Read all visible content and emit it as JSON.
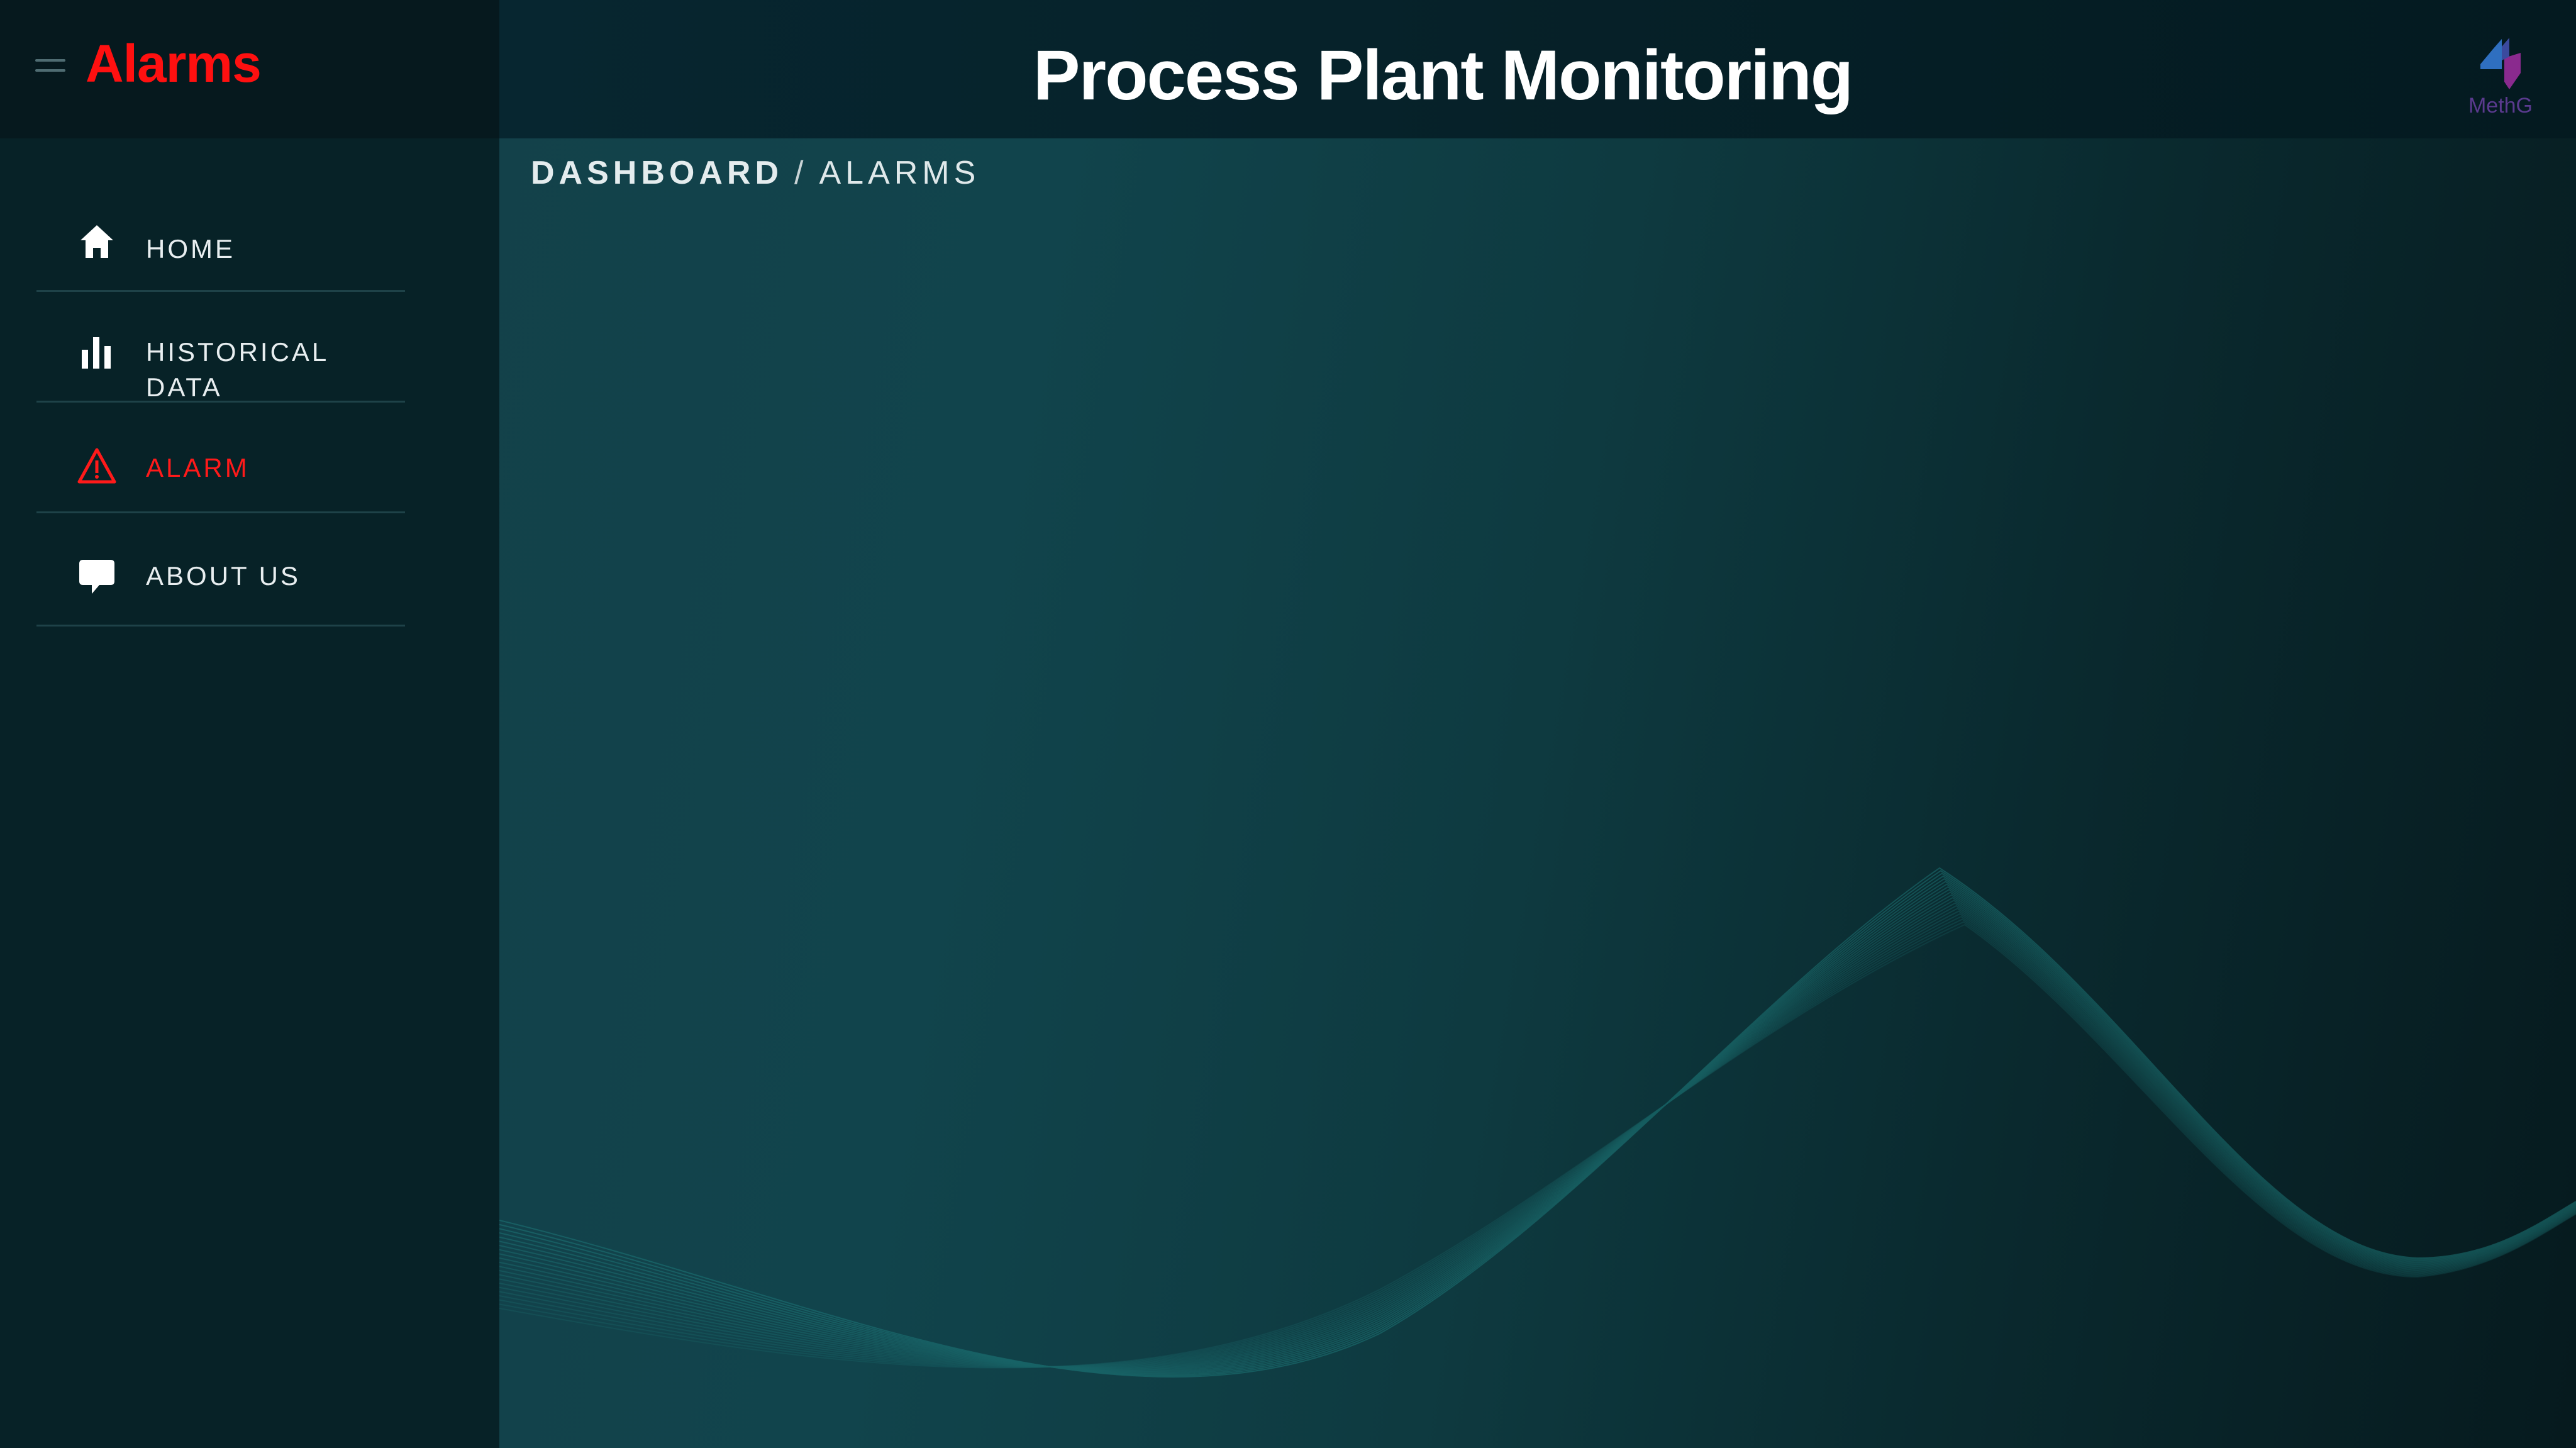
{
  "sidebar": {
    "title": "Alarms",
    "menu_icon": "hamburger-menu-icon",
    "items": [
      {
        "label": "HOME",
        "icon": "home-icon",
        "active": false
      },
      {
        "label": "HISTORICAL DATA",
        "icon": "bar-chart-icon",
        "active": false
      },
      {
        "label": "ALARM",
        "icon": "warning-triangle-icon",
        "active": true
      },
      {
        "label": "ABOUT US",
        "icon": "speech-bubble-icon",
        "active": false
      }
    ]
  },
  "header": {
    "title": "Process Plant Monitoring",
    "logo_text": "MethG",
    "logo_icon": "methg-logo"
  },
  "breadcrumb": {
    "root": "DASHBOARD",
    "separator": "/",
    "current": "ALARMS"
  },
  "colors": {
    "accent": "#ff1a1a",
    "sidebar_bg": "#072227",
    "header_bg": "#06191e",
    "text": "#ffffff",
    "wave": "#1f7f7f",
    "logo_blue": "#2f6fc0",
    "logo_purple": "#8a2a8e"
  }
}
